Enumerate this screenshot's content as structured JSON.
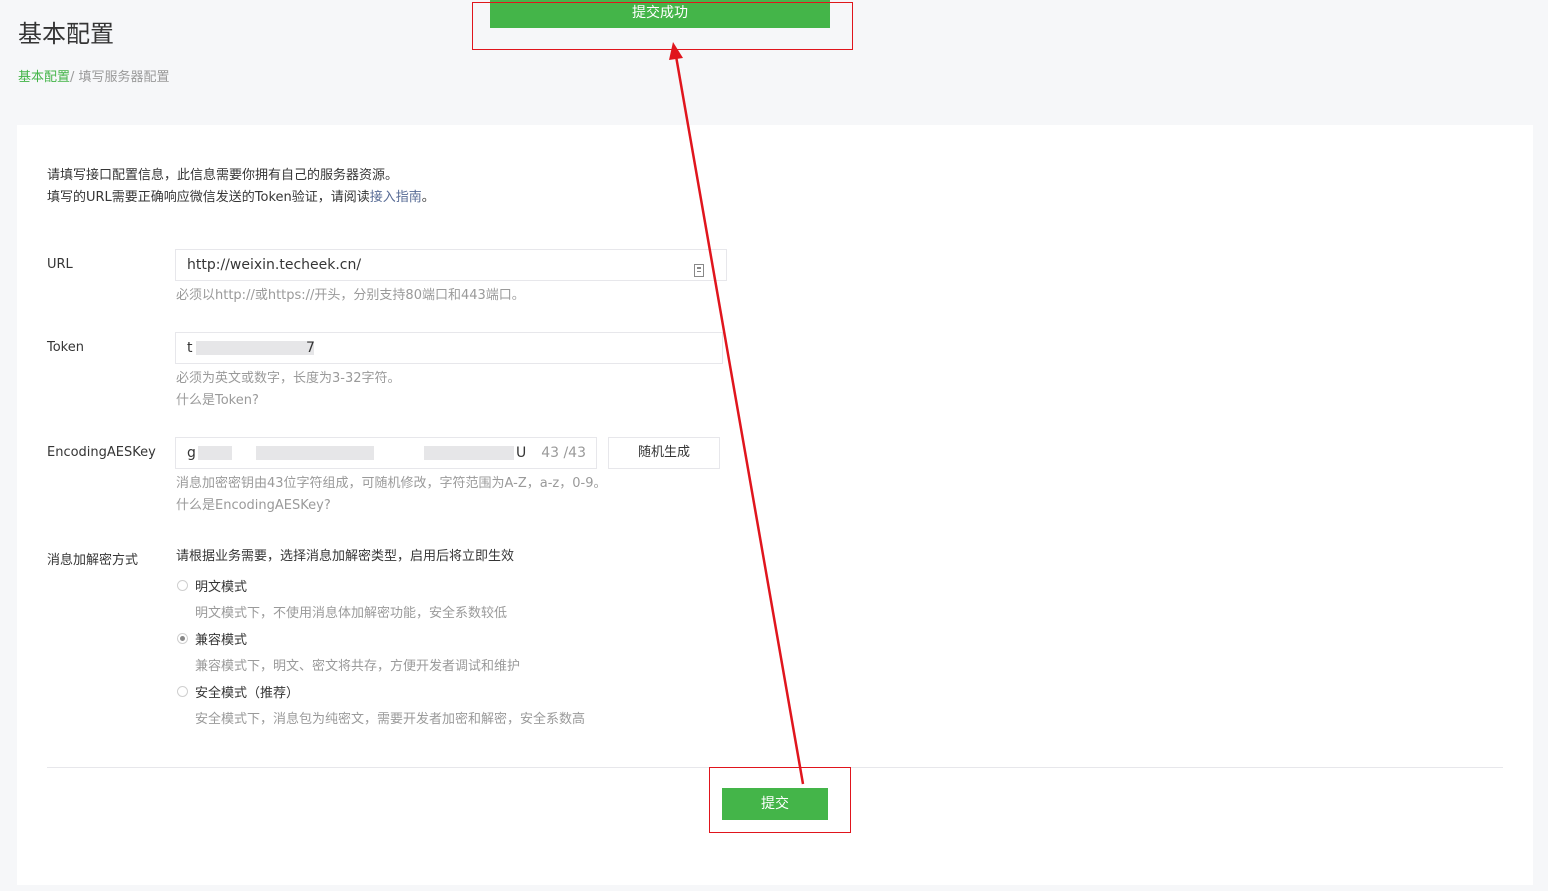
{
  "header": {
    "title": "基本配置",
    "breadcrumb": {
      "link": "基本配置",
      "separator": "/ ",
      "current": "填写服务器配置"
    }
  },
  "toast": {
    "text": "提交成功"
  },
  "intro": {
    "line1": "请填写接口配置信息，此信息需要你拥有自己的服务器资源。",
    "line2_prefix": "填写的URL需要正确响应微信发送的Token验证，请阅读",
    "line2_link": "接入指南",
    "line2_suffix": "。"
  },
  "form": {
    "url": {
      "label": "URL",
      "value": "http://weixin.techeek.cn/",
      "hint": "必须以http://或https://开头，分别支持80端口和443端口。"
    },
    "token": {
      "label": "Token",
      "value_start": "t",
      "value_end": "7",
      "hint": "必须为英文或数字，长度为3-32字符。",
      "help_link": "什么是Token?"
    },
    "aeskey": {
      "label": "EncodingAESKey",
      "value_start": "g",
      "value_end": "U",
      "counter": "43 /43",
      "generate_button": "随机生成",
      "hint": "消息加密密钥由43位字符组成，可随机修改，字符范围为A-Z，a-z，0-9。",
      "help_link": "什么是EncodingAESKey?"
    },
    "encryption": {
      "label": "消息加解密方式",
      "instruction": "请根据业务需要，选择消息加解密类型，启用后将立即生效",
      "options": [
        {
          "label": "明文模式",
          "desc": "明文模式下，不使用消息体加解密功能，安全系数较低",
          "checked": false
        },
        {
          "label": "兼容模式",
          "desc": "兼容模式下，明文、密文将共存，方便开发者调试和维护",
          "checked": true
        },
        {
          "label": "安全模式（推荐）",
          "desc": "安全模式下，消息包为纯密文，需要开发者加密和解密，安全系数高",
          "checked": false
        }
      ]
    },
    "submit_button": "提交"
  },
  "colors": {
    "brand_green": "#44b549",
    "link": "#576b95",
    "annotation_red": "#e0151d"
  },
  "icons": {
    "url_field": "clipboard-icon"
  }
}
